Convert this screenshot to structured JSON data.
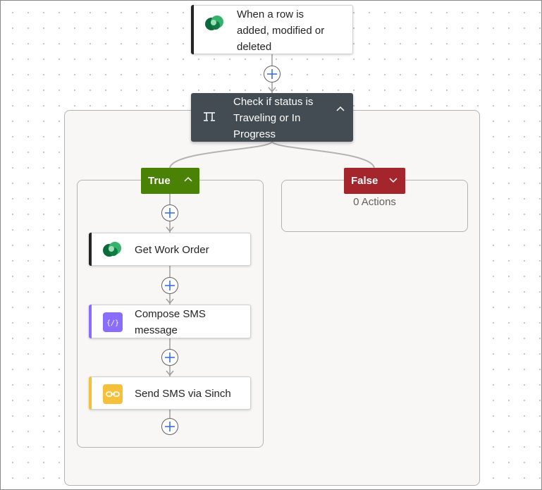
{
  "trigger": {
    "title_line1": "When a row is",
    "title_line2": "added, modified or",
    "title_line3": "deleted",
    "icon": "dataverse-icon"
  },
  "condition": {
    "title_line1": "Check if status is",
    "title_line2": "Traveling or In",
    "title_line3": "Progress",
    "icon": "condition-icon"
  },
  "branches": {
    "true_label": "True",
    "false_label": "False",
    "false_empty": "0 Actions"
  },
  "actions": [
    {
      "title_line1": "Get Work Order",
      "title_line2": "",
      "icon": "dataverse-icon",
      "accent": "#242424"
    },
    {
      "title_line1": "Compose SMS",
      "title_line2": "message",
      "icon": "compose-icon",
      "accent": "#8a6cff"
    },
    {
      "title_line1": "Send SMS via Sinch",
      "title_line2": "",
      "icon": "sinch-icon",
      "accent": "#f5c13a"
    }
  ],
  "colors": {
    "true": "#498205",
    "false": "#a4262c",
    "condition": "#434b53",
    "add_plus": "#3a6fd8"
  }
}
